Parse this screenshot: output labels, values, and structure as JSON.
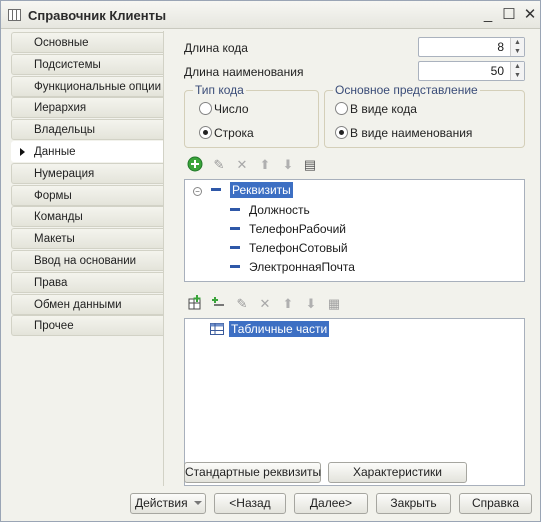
{
  "window": {
    "title": "Справочник Клиенты",
    "controls": {
      "minimize": "_",
      "maximize": "☐",
      "close": "✕"
    }
  },
  "tabs": [
    {
      "label": "Основные"
    },
    {
      "label": "Подсистемы"
    },
    {
      "label": "Функциональные опции"
    },
    {
      "label": "Иерархия"
    },
    {
      "label": "Владельцы"
    },
    {
      "label": "Данные",
      "active": true
    },
    {
      "label": "Нумерация"
    },
    {
      "label": "Формы"
    },
    {
      "label": "Команды"
    },
    {
      "label": "Макеты"
    },
    {
      "label": "Ввод на основании"
    },
    {
      "label": "Права"
    },
    {
      "label": "Обмен данными"
    },
    {
      "label": "Прочее"
    }
  ],
  "data_tab": {
    "code_length": {
      "label": "Длина кода",
      "value": "8"
    },
    "name_length": {
      "label": "Длина наименования",
      "value": "50"
    },
    "code_type": {
      "title": "Тип кода",
      "options": [
        {
          "label": "Число",
          "selected": false
        },
        {
          "label": "Строка",
          "selected": true
        }
      ]
    },
    "main_presentation": {
      "title": "Основное представление",
      "options": [
        {
          "label": "В виде кода",
          "selected": false
        },
        {
          "label": "В виде наименования",
          "selected": true
        }
      ]
    },
    "attributes_tree": {
      "root": "Реквизиты",
      "items": [
        "Должность",
        "ТелефонРабочий",
        "ТелефонСотовый",
        "ЭлектроннаяПочта"
      ]
    },
    "tabular_tree": {
      "root": "Табличные части"
    },
    "standard_attributes_button": "Стандартные реквизиты",
    "characteristics_button": "Характеристики"
  },
  "footer": {
    "actions_label": "Действия",
    "back_label": "<Назад",
    "next_label": "Далее>",
    "close_label": "Закрыть",
    "help_label": "Справка"
  },
  "colors": {
    "selection": "#3d6fc3",
    "group_title": "#3a4c78",
    "add_icon": "#3aa43a"
  }
}
